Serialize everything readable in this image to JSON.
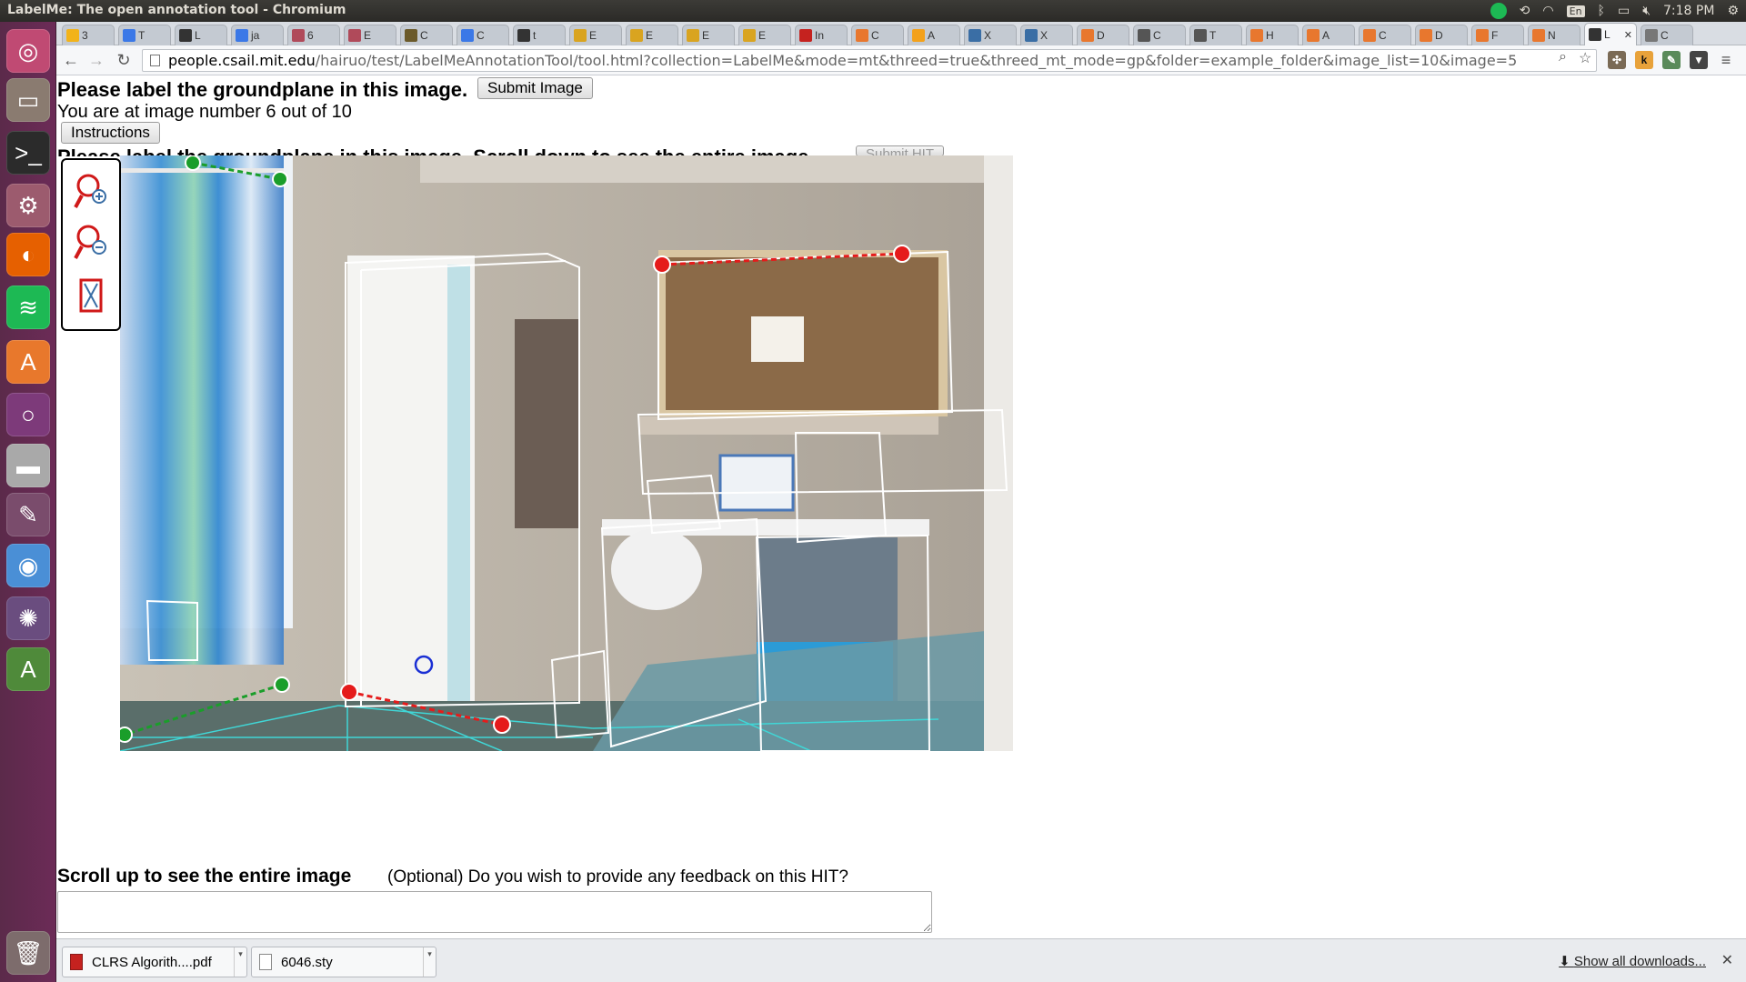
{
  "os": {
    "window_title": "LabelMe: The open annotation tool - Chromium",
    "clock": "7:18 PM",
    "keyboard_layout": "En"
  },
  "launcher": {
    "items": [
      {
        "name": "ubuntu-dash-icon",
        "color": "#c04a73",
        "glyph": "◎"
      },
      {
        "name": "files-icon",
        "color": "#8a7b70",
        "glyph": "▭"
      },
      {
        "name": "terminal-icon",
        "color": "#2b2b2b",
        "glyph": ">_"
      },
      {
        "name": "system-settings-icon",
        "color": "#9c5b6e",
        "glyph": "⚙"
      },
      {
        "name": "firefox-icon",
        "color": "#e66000",
        "glyph": "◐"
      },
      {
        "name": "spotify-icon",
        "color": "#1db954",
        "glyph": "≋"
      },
      {
        "name": "software-center-icon",
        "color": "#e8782c",
        "glyph": "A"
      },
      {
        "name": "unity-lens-icon",
        "color": "#7d3a7a",
        "glyph": "○"
      },
      {
        "name": "disk-icon",
        "color": "#a9a9a9",
        "glyph": "▬"
      },
      {
        "name": "editor-icon",
        "color": "#7a4c6c",
        "glyph": "✎"
      },
      {
        "name": "chromium-icon",
        "color": "#4a8fd6",
        "glyph": "◉"
      },
      {
        "name": "shotwell-icon",
        "color": "#6a4d7f",
        "glyph": "✺"
      },
      {
        "name": "update-manager-icon",
        "color": "#4f8a3a",
        "glyph": "A"
      },
      {
        "name": "trash-icon",
        "color": "#7d6c6c",
        "glyph": "🗑"
      }
    ]
  },
  "browser": {
    "tabs": [
      {
        "label": "3",
        "color": "#f2b31a"
      },
      {
        "label": "T",
        "color": "#3b78e7"
      },
      {
        "label": "L",
        "color": "#333333"
      },
      {
        "label": "ja",
        "color": "#3b78e7"
      },
      {
        "label": "6",
        "color": "#b04a5a"
      },
      {
        "label": "E",
        "color": "#b04a5a"
      },
      {
        "label": "C",
        "color": "#6b5a2a"
      },
      {
        "label": "C",
        "color": "#3b78e7"
      },
      {
        "label": "t",
        "color": "#333333"
      },
      {
        "label": "E",
        "color": "#d9a420"
      },
      {
        "label": "E",
        "color": "#d9a420"
      },
      {
        "label": "E",
        "color": "#d9a420"
      },
      {
        "label": "E",
        "color": "#d9a420"
      },
      {
        "label": "In",
        "color": "#c5221f"
      },
      {
        "label": "C",
        "color": "#e8772e"
      },
      {
        "label": "A",
        "color": "#f3a11b"
      },
      {
        "label": "X",
        "color": "#3a6ea5"
      },
      {
        "label": "X",
        "color": "#3a6ea5"
      },
      {
        "label": "D",
        "color": "#e8772e"
      },
      {
        "label": "C",
        "color": "#555555"
      },
      {
        "label": "T",
        "color": "#555555"
      },
      {
        "label": "H",
        "color": "#e8772e"
      },
      {
        "label": "A",
        "color": "#e8772e"
      },
      {
        "label": "C",
        "color": "#e8772e"
      },
      {
        "label": "D",
        "color": "#e8772e"
      },
      {
        "label": "F",
        "color": "#e8772e"
      },
      {
        "label": "N",
        "color": "#e8772e"
      },
      {
        "label": "L",
        "color": "#333333",
        "active": true
      },
      {
        "label": "C",
        "color": "#777777"
      }
    ],
    "url_host": "people.csail.mit.edu",
    "url_path": "/hairuo/test/LabelMeAnnotationTool/tool.html?collection=LabelMe&mode=mt&threed=true&threed_mt_mode=gp&folder=example_folder&image_list=10&image=5"
  },
  "page": {
    "heading": "Please label the groundplane in this image.",
    "submit_image_label": "Submit Image",
    "progress_text": "You are at image number 6 out of 10",
    "instructions_label": "Instructions",
    "hidden_heading": "Please label the groundplane in this image. Scroll down to see the entire image.",
    "submit_hit_label": "Submit HIT",
    "scroll_up_text": "Scroll up to see the entire image",
    "feedback_prompt": "(Optional) Do you wish to provide any feedback on this HIT?",
    "feedback_value": ""
  },
  "tools": [
    {
      "name": "zoom-in-icon"
    },
    {
      "name": "zoom-out-icon"
    },
    {
      "name": "fit-image-icon"
    }
  ],
  "downloads": {
    "items": [
      {
        "label": "CLRS Algorith....pdf",
        "icon": "pdf-file-icon"
      },
      {
        "label": "6046.sty",
        "icon": "text-file-icon"
      }
    ],
    "show_all": "Show all downloads..."
  },
  "colors": {
    "groundplane_green": "#1a9e2a",
    "groundplane_red": "#e51b1b",
    "groundplane_blue": "#1a2fd4",
    "floor_grid": "#40d6d6",
    "box_wireframe": "#ffffff"
  }
}
